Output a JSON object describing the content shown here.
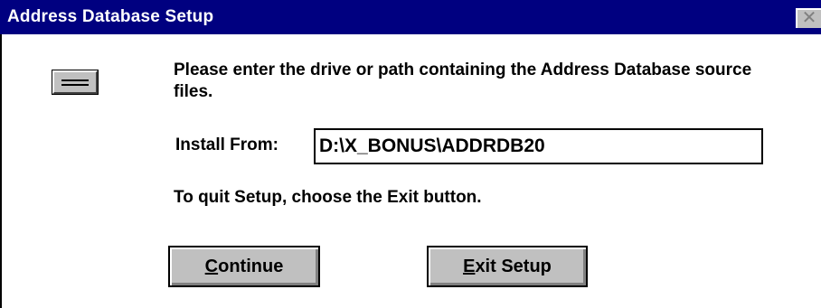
{
  "window": {
    "title": "Address Database Setup",
    "close_glyph": "✕"
  },
  "dialog": {
    "prompt": "Please enter the drive or path containing the Address Database source files.",
    "install_label": "Install From:",
    "install_value": "D:\\X_BONUS\\ADDRDB20",
    "quit_text": "To quit Setup, choose the Exit button."
  },
  "buttons": {
    "continue_mnemonic": "C",
    "continue_rest": "ontinue",
    "exit_mnemonic": "E",
    "exit_rest": "xit Setup"
  },
  "icons": {
    "setup": "setup-icon",
    "close": "close-icon"
  },
  "colors": {
    "titlebar": "#000080",
    "button_face": "#c0c0c0"
  }
}
